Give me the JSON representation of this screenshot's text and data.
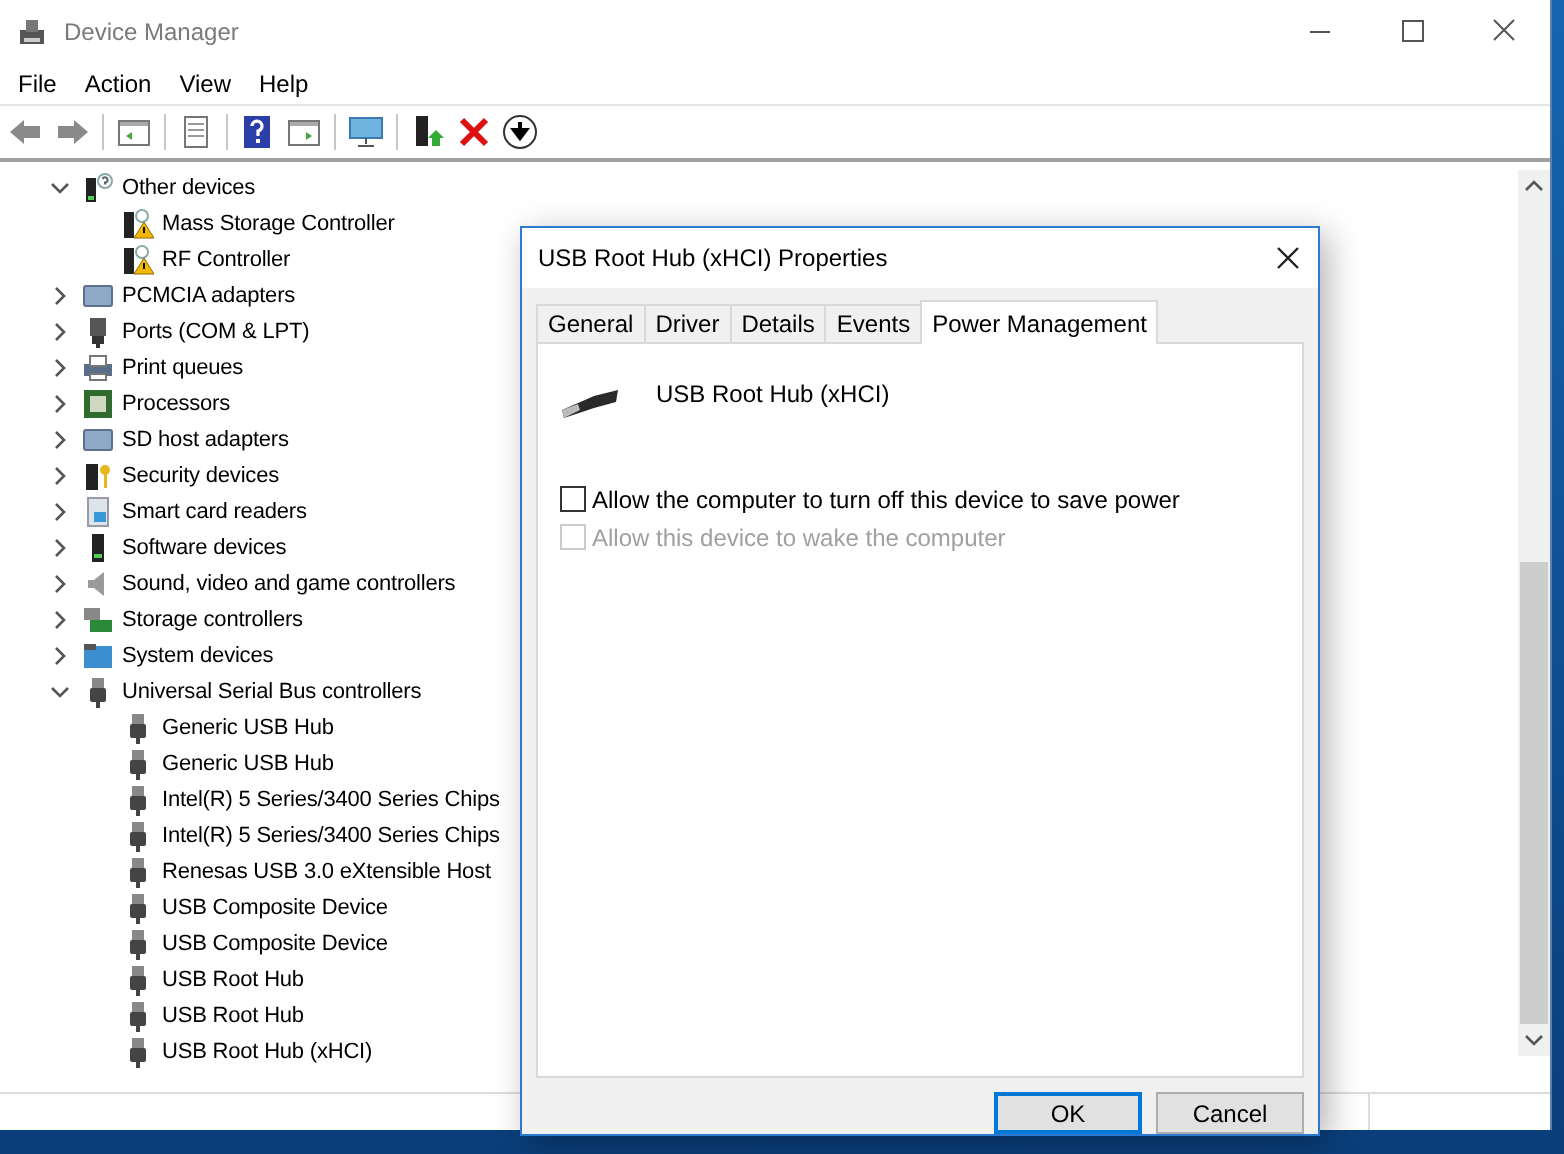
{
  "window": {
    "title": "Device Manager"
  },
  "menu": [
    "File",
    "Action",
    "View",
    "Help"
  ],
  "tree": [
    {
      "label": "Other devices",
      "kind": "unknown",
      "expanded": true,
      "children": [
        {
          "label": "Mass Storage Controller",
          "kind": "warning"
        },
        {
          "label": "RF Controller",
          "kind": "warning"
        }
      ]
    },
    {
      "label": "PCMCIA adapters",
      "kind": "card",
      "expanded": false
    },
    {
      "label": "Ports (COM & LPT)",
      "kind": "port",
      "expanded": false
    },
    {
      "label": "Print queues",
      "kind": "printer",
      "expanded": false
    },
    {
      "label": "Processors",
      "kind": "chip",
      "expanded": false
    },
    {
      "label": "SD host adapters",
      "kind": "card",
      "expanded": false
    },
    {
      "label": "Security devices",
      "kind": "key",
      "expanded": false
    },
    {
      "label": "Smart card readers",
      "kind": "reader",
      "expanded": false
    },
    {
      "label": "Software devices",
      "kind": "tower",
      "expanded": false
    },
    {
      "label": "Sound, video and game controllers",
      "kind": "speaker",
      "expanded": false
    },
    {
      "label": "Storage controllers",
      "kind": "storage",
      "expanded": false
    },
    {
      "label": "System devices",
      "kind": "system",
      "expanded": false
    },
    {
      "label": "Universal Serial Bus controllers",
      "kind": "usb",
      "expanded": true,
      "children": [
        {
          "label": "Generic USB Hub",
          "kind": "usb"
        },
        {
          "label": "Generic USB Hub",
          "kind": "usb"
        },
        {
          "label": "Intel(R) 5 Series/3400 Series Chips",
          "kind": "usb"
        },
        {
          "label": "Intel(R) 5 Series/3400 Series Chips",
          "kind": "usb"
        },
        {
          "label": "Renesas USB 3.0 eXtensible Host",
          "kind": "usb"
        },
        {
          "label": "USB Composite Device",
          "kind": "usb"
        },
        {
          "label": "USB Composite Device",
          "kind": "usb"
        },
        {
          "label": "USB Root Hub",
          "kind": "usb"
        },
        {
          "label": "USB Root Hub",
          "kind": "usb"
        },
        {
          "label": "USB Root Hub (xHCI)",
          "kind": "usb"
        }
      ]
    }
  ],
  "dialog": {
    "title": "USB Root Hub (xHCI) Properties",
    "tabs": [
      {
        "label": "General",
        "selected": false
      },
      {
        "label": "Driver",
        "selected": false
      },
      {
        "label": "Details",
        "selected": false
      },
      {
        "label": "Events",
        "selected": false
      },
      {
        "label": "Power Management",
        "selected": true
      }
    ],
    "device_name": "USB Root Hub (xHCI)",
    "options": [
      {
        "label": "Allow the computer to turn off this device to save power",
        "checked": false,
        "disabled": false
      },
      {
        "label": "Allow this device to wake the computer",
        "checked": false,
        "disabled": true
      }
    ],
    "buttons": [
      {
        "label": "OK",
        "default": true
      },
      {
        "label": "Cancel",
        "default": false
      }
    ]
  }
}
